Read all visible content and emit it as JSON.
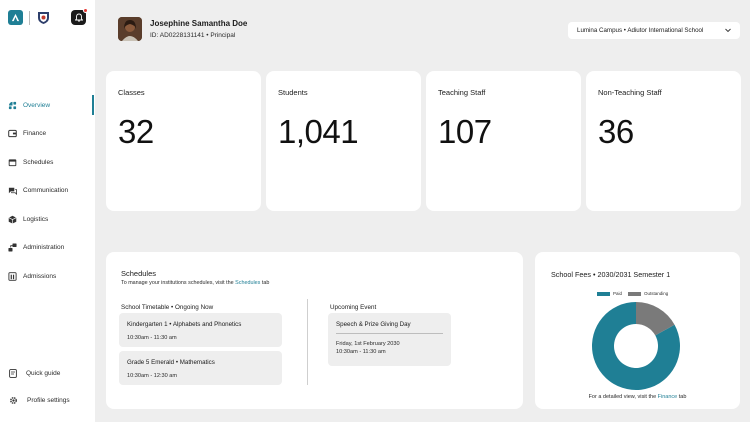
{
  "sidebar": {
    "nav": [
      {
        "label": "Overview",
        "icon": "overview-icon",
        "active": true
      },
      {
        "label": "Finance",
        "icon": "finance-icon"
      },
      {
        "label": "Schedules",
        "icon": "schedules-icon"
      },
      {
        "label": "Communication",
        "icon": "communication-icon"
      },
      {
        "label": "Logistics",
        "icon": "logistics-icon"
      },
      {
        "label": "Administration",
        "icon": "administration-icon"
      },
      {
        "label": "Admissions",
        "icon": "admissions-icon"
      }
    ],
    "bottom": [
      {
        "label": "Quick guide",
        "icon": "quick-guide-icon"
      },
      {
        "label": "Profile settings",
        "icon": "gear-icon"
      }
    ]
  },
  "header": {
    "user_name": "Josephine Samantha Doe",
    "user_meta": "ID: AD0228131141 • Principal",
    "campus": "Lumina Campus • Adiutor International School"
  },
  "stats": [
    {
      "label": "Classes",
      "value": "32"
    },
    {
      "label": "Students",
      "value": "1,041"
    },
    {
      "label": "Teaching Staff",
      "value": "107"
    },
    {
      "label": "Non-Teaching Staff",
      "value": "36"
    }
  ],
  "schedules": {
    "title": "Schedules",
    "subtitle_pre": "To manage your institutions schedules, visit the ",
    "subtitle_link": "Schedules",
    "subtitle_post": " tab",
    "timetable_head": "School Timetable  •  Ongoing Now",
    "timetable": [
      {
        "title": "Kindergarten 1  •  Alphabets and Phonetics",
        "time": "10:30am - 11:30 am"
      },
      {
        "title": "Grade 5 Emerald  •  Mathematics",
        "time": "10:30am - 12:30 am"
      }
    ],
    "upcoming_head": "Upcoming Event",
    "upcoming": {
      "title": "Speech & Prize Giving Day",
      "date": "Friday, 1st February 2030",
      "time": "10:30am - 11:30 am"
    }
  },
  "fees": {
    "title": "School Fees • 2030/2031 Semester 1",
    "foot_pre": "For a detailed view, visit the ",
    "foot_link": "Finance",
    "foot_post": " tab"
  },
  "chart_data": {
    "type": "pie",
    "title": "School Fees • 2030/2031 Semester 1",
    "donut": true,
    "legend_placement": "top",
    "series": [
      {
        "name": "Paid",
        "value": 83,
        "color": "#1f7f95"
      },
      {
        "name": "Outstanding",
        "value": 17,
        "color": "#7a7a7a"
      }
    ]
  },
  "colors": {
    "accent": "#1f7f95",
    "outstanding": "#7a7a7a"
  }
}
